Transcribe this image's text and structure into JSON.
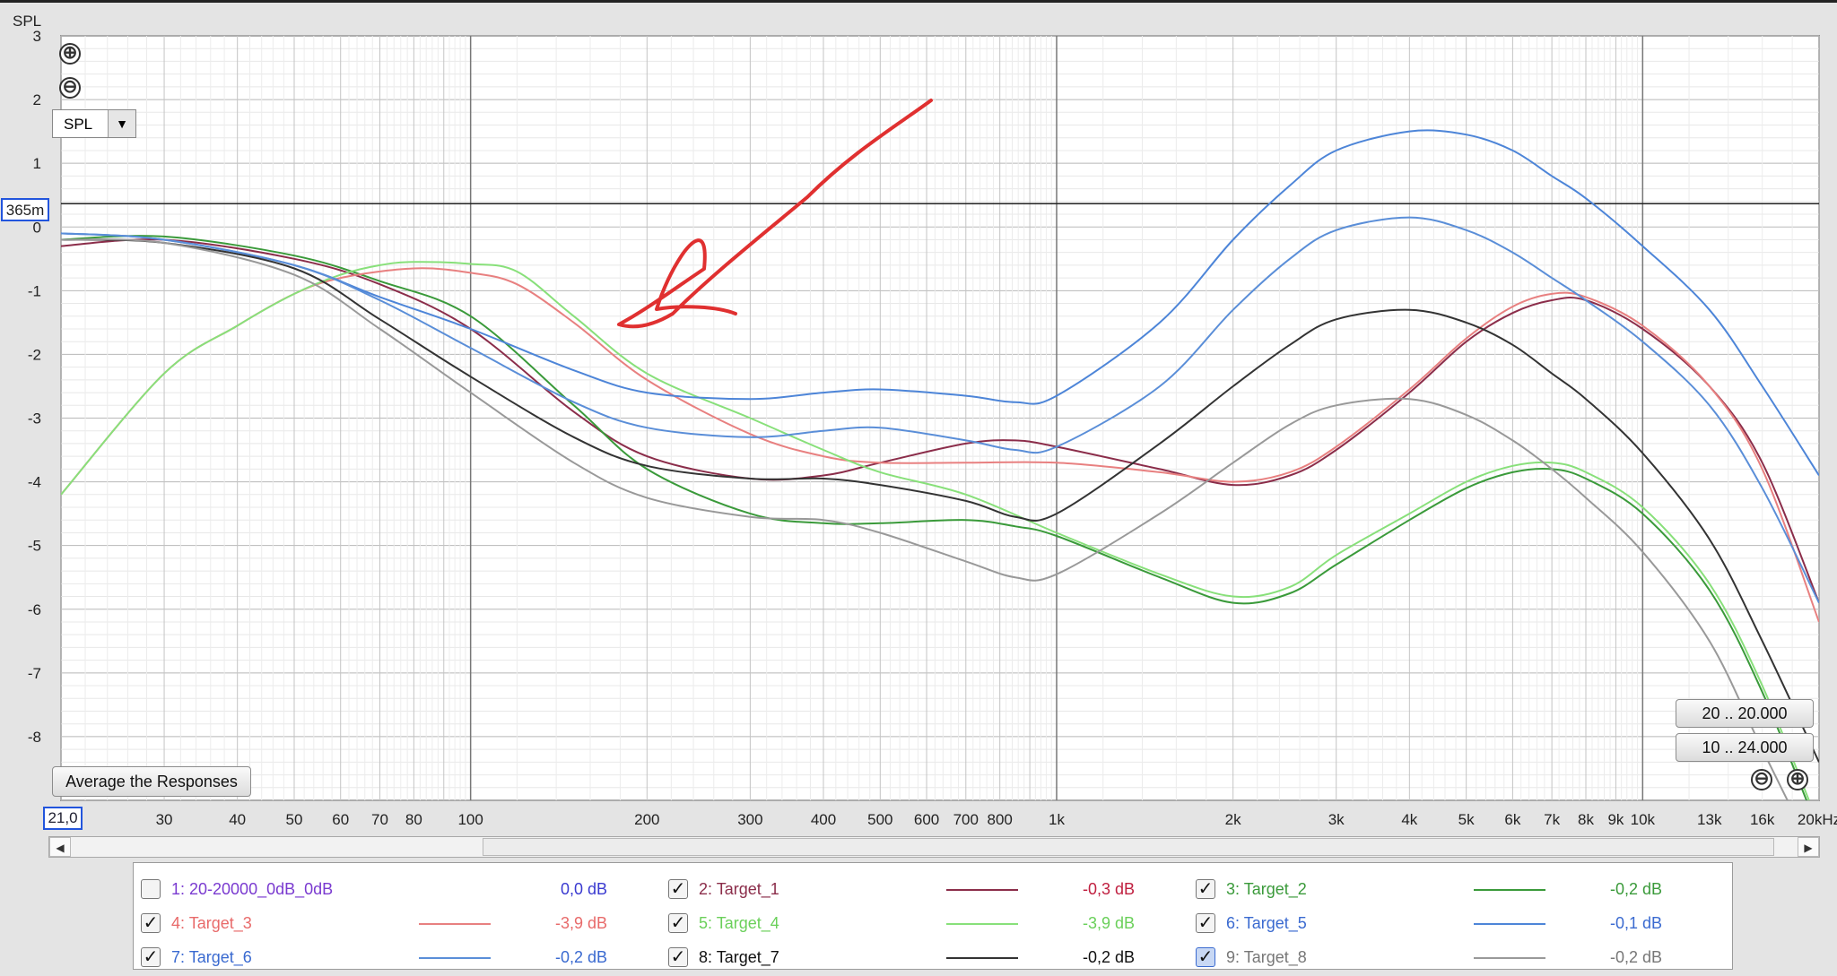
{
  "chart_data": {
    "type": "line",
    "title": "",
    "ylabel": "SPL",
    "xlabel": "",
    "x_scale": "log",
    "xlim": [
      20,
      20000
    ],
    "ylim": [
      -9,
      3
    ],
    "y_ticks": [
      "3",
      "2",
      "1",
      "0",
      "-1",
      "-2",
      "-3",
      "-4",
      "-5",
      "-6",
      "-7",
      "-8"
    ],
    "x_tick_labels": [
      {
        "f": 30,
        "t": "30"
      },
      {
        "f": 40,
        "t": "40"
      },
      {
        "f": 50,
        "t": "50"
      },
      {
        "f": 60,
        "t": "60"
      },
      {
        "f": 70,
        "t": "70"
      },
      {
        "f": 80,
        "t": "80"
      },
      {
        "f": 100,
        "t": "100"
      },
      {
        "f": 200,
        "t": "200"
      },
      {
        "f": 300,
        "t": "300"
      },
      {
        "f": 400,
        "t": "400"
      },
      {
        "f": 500,
        "t": "500"
      },
      {
        "f": 600,
        "t": "600"
      },
      {
        "f": 700,
        "t": "700"
      },
      {
        "f": 800,
        "t": "800"
      },
      {
        "f": 1000,
        "t": "1k"
      },
      {
        "f": 2000,
        "t": "2k"
      },
      {
        "f": 3000,
        "t": "3k"
      },
      {
        "f": 4000,
        "t": "4k"
      },
      {
        "f": 5000,
        "t": "5k"
      },
      {
        "f": 6000,
        "t": "6k"
      },
      {
        "f": 7000,
        "t": "7k"
      },
      {
        "f": 8000,
        "t": "8k"
      },
      {
        "f": 9000,
        "t": "9k"
      },
      {
        "f": 10000,
        "t": "10k"
      },
      {
        "f": 13000,
        "t": "13k"
      },
      {
        "f": 16000,
        "t": "16k"
      },
      {
        "f": 20000,
        "t": "20kHz"
      }
    ],
    "cursor_value": "365m",
    "cursor_y": 0.365,
    "start_freq_label": "21,0",
    "series": [
      {
        "name": "Target_1",
        "color": "#8b2d4a",
        "points": [
          [
            20,
            -0.3
          ],
          [
            30,
            -0.2
          ],
          [
            50,
            -0.5
          ],
          [
            70,
            -0.9
          ],
          [
            100,
            -1.6
          ],
          [
            150,
            -2.9
          ],
          [
            200,
            -3.6
          ],
          [
            300,
            -3.95
          ],
          [
            400,
            -3.9
          ],
          [
            500,
            -3.7
          ],
          [
            700,
            -3.4
          ],
          [
            850,
            -3.35
          ],
          [
            1000,
            -3.45
          ],
          [
            1500,
            -3.8
          ],
          [
            2000,
            -4.05
          ],
          [
            2500,
            -3.9
          ],
          [
            3000,
            -3.5
          ],
          [
            4000,
            -2.6
          ],
          [
            5000,
            -1.8
          ],
          [
            6000,
            -1.35
          ],
          [
            7000,
            -1.15
          ],
          [
            8000,
            -1.15
          ],
          [
            10000,
            -1.6
          ],
          [
            13000,
            -2.5
          ],
          [
            16000,
            -3.7
          ],
          [
            20000,
            -5.9
          ]
        ]
      },
      {
        "name": "Target_2",
        "color": "#3a9a3a",
        "points": [
          [
            20,
            -0.2
          ],
          [
            30,
            -0.15
          ],
          [
            50,
            -0.45
          ],
          [
            70,
            -0.85
          ],
          [
            100,
            -1.4
          ],
          [
            150,
            -2.8
          ],
          [
            200,
            -3.8
          ],
          [
            300,
            -4.5
          ],
          [
            400,
            -4.65
          ],
          [
            500,
            -4.65
          ],
          [
            700,
            -4.6
          ],
          [
            850,
            -4.7
          ],
          [
            1000,
            -4.85
          ],
          [
            1500,
            -5.5
          ],
          [
            2000,
            -5.9
          ],
          [
            2500,
            -5.75
          ],
          [
            3000,
            -5.3
          ],
          [
            4000,
            -4.6
          ],
          [
            5000,
            -4.1
          ],
          [
            6000,
            -3.85
          ],
          [
            7000,
            -3.8
          ],
          [
            8000,
            -3.95
          ],
          [
            10000,
            -4.5
          ],
          [
            13000,
            -5.7
          ],
          [
            16000,
            -7.3
          ],
          [
            20000,
            -9.5
          ]
        ]
      },
      {
        "name": "Target_3",
        "color": "#e88080",
        "points": [
          [
            20,
            -4.2
          ],
          [
            30,
            -2.3
          ],
          [
            40,
            -1.55
          ],
          [
            50,
            -1.05
          ],
          [
            60,
            -0.8
          ],
          [
            80,
            -0.65
          ],
          [
            100,
            -0.72
          ],
          [
            120,
            -0.9
          ],
          [
            150,
            -1.5
          ],
          [
            200,
            -2.4
          ],
          [
            300,
            -3.25
          ],
          [
            400,
            -3.6
          ],
          [
            500,
            -3.7
          ],
          [
            700,
            -3.7
          ],
          [
            1000,
            -3.7
          ],
          [
            1500,
            -3.85
          ],
          [
            2000,
            -4.0
          ],
          [
            2500,
            -3.85
          ],
          [
            3000,
            -3.45
          ],
          [
            4000,
            -2.55
          ],
          [
            5000,
            -1.75
          ],
          [
            6000,
            -1.25
          ],
          [
            7000,
            -1.05
          ],
          [
            8000,
            -1.1
          ],
          [
            10000,
            -1.55
          ],
          [
            13000,
            -2.5
          ],
          [
            16000,
            -3.8
          ],
          [
            20000,
            -6.2
          ]
        ]
      },
      {
        "name": "Target_4",
        "color": "#88e07a",
        "points": [
          [
            20,
            -4.2
          ],
          [
            30,
            -2.3
          ],
          [
            40,
            -1.55
          ],
          [
            50,
            -1.05
          ],
          [
            60,
            -0.75
          ],
          [
            70,
            -0.6
          ],
          [
            80,
            -0.55
          ],
          [
            100,
            -0.58
          ],
          [
            120,
            -0.7
          ],
          [
            150,
            -1.4
          ],
          [
            200,
            -2.3
          ],
          [
            300,
            -3.0
          ],
          [
            400,
            -3.5
          ],
          [
            500,
            -3.85
          ],
          [
            700,
            -4.2
          ],
          [
            1000,
            -4.8
          ],
          [
            1500,
            -5.45
          ],
          [
            2000,
            -5.8
          ],
          [
            2500,
            -5.65
          ],
          [
            3000,
            -5.15
          ],
          [
            4000,
            -4.5
          ],
          [
            5000,
            -4.0
          ],
          [
            6000,
            -3.75
          ],
          [
            7000,
            -3.7
          ],
          [
            8000,
            -3.85
          ],
          [
            10000,
            -4.4
          ],
          [
            13000,
            -5.6
          ],
          [
            16000,
            -7.2
          ],
          [
            20000,
            -9.4
          ]
        ]
      },
      {
        "name": "Target_5",
        "color": "#4d85d8",
        "points": [
          [
            20,
            -0.1
          ],
          [
            30,
            -0.2
          ],
          [
            50,
            -0.6
          ],
          [
            70,
            -1.1
          ],
          [
            100,
            -1.6
          ],
          [
            150,
            -2.25
          ],
          [
            200,
            -2.6
          ],
          [
            300,
            -2.7
          ],
          [
            400,
            -2.6
          ],
          [
            500,
            -2.55
          ],
          [
            700,
            -2.65
          ],
          [
            850,
            -2.75
          ],
          [
            1000,
            -2.65
          ],
          [
            1500,
            -1.5
          ],
          [
            2000,
            -0.2
          ],
          [
            2500,
            0.65
          ],
          [
            3000,
            1.2
          ],
          [
            4000,
            1.5
          ],
          [
            5000,
            1.45
          ],
          [
            6000,
            1.2
          ],
          [
            7000,
            0.8
          ],
          [
            8000,
            0.45
          ],
          [
            10000,
            -0.3
          ],
          [
            13000,
            -1.3
          ],
          [
            16000,
            -2.5
          ],
          [
            20000,
            -3.9
          ]
        ]
      },
      {
        "name": "Target_6",
        "color": "#5a8ed8",
        "points": [
          [
            20,
            -0.1
          ],
          [
            30,
            -0.2
          ],
          [
            50,
            -0.6
          ],
          [
            70,
            -1.15
          ],
          [
            100,
            -1.9
          ],
          [
            150,
            -2.75
          ],
          [
            200,
            -3.15
          ],
          [
            300,
            -3.3
          ],
          [
            400,
            -3.2
          ],
          [
            500,
            -3.15
          ],
          [
            700,
            -3.35
          ],
          [
            850,
            -3.5
          ],
          [
            1000,
            -3.45
          ],
          [
            1500,
            -2.5
          ],
          [
            2000,
            -1.3
          ],
          [
            2500,
            -0.5
          ],
          [
            3000,
            -0.05
          ],
          [
            4000,
            0.15
          ],
          [
            5000,
            -0.05
          ],
          [
            6000,
            -0.4
          ],
          [
            7000,
            -0.8
          ],
          [
            8000,
            -1.15
          ],
          [
            10000,
            -1.8
          ],
          [
            13000,
            -2.8
          ],
          [
            16000,
            -4.1
          ],
          [
            20000,
            -5.9
          ]
        ]
      },
      {
        "name": "Target_7",
        "color": "#333333",
        "points": [
          [
            20,
            -0.2
          ],
          [
            30,
            -0.25
          ],
          [
            50,
            -0.65
          ],
          [
            70,
            -1.45
          ],
          [
            100,
            -2.35
          ],
          [
            150,
            -3.3
          ],
          [
            200,
            -3.75
          ],
          [
            300,
            -3.95
          ],
          [
            400,
            -3.95
          ],
          [
            500,
            -4.05
          ],
          [
            700,
            -4.3
          ],
          [
            850,
            -4.55
          ],
          [
            1000,
            -4.5
          ],
          [
            1500,
            -3.4
          ],
          [
            2000,
            -2.5
          ],
          [
            2500,
            -1.85
          ],
          [
            3000,
            -1.45
          ],
          [
            4000,
            -1.3
          ],
          [
            5000,
            -1.5
          ],
          [
            6000,
            -1.85
          ],
          [
            7000,
            -2.3
          ],
          [
            8000,
            -2.7
          ],
          [
            10000,
            -3.55
          ],
          [
            13000,
            -4.9
          ],
          [
            16000,
            -6.5
          ],
          [
            20000,
            -8.4
          ]
        ]
      },
      {
        "name": "Target_8",
        "color": "#999999",
        "points": [
          [
            20,
            -0.2
          ],
          [
            30,
            -0.25
          ],
          [
            50,
            -0.75
          ],
          [
            70,
            -1.6
          ],
          [
            100,
            -2.6
          ],
          [
            150,
            -3.7
          ],
          [
            200,
            -4.25
          ],
          [
            300,
            -4.55
          ],
          [
            400,
            -4.6
          ],
          [
            500,
            -4.8
          ],
          [
            700,
            -5.25
          ],
          [
            850,
            -5.5
          ],
          [
            1000,
            -5.45
          ],
          [
            1500,
            -4.5
          ],
          [
            2000,
            -3.7
          ],
          [
            2500,
            -3.1
          ],
          [
            3000,
            -2.8
          ],
          [
            4000,
            -2.7
          ],
          [
            5000,
            -2.95
          ],
          [
            6000,
            -3.35
          ],
          [
            7000,
            -3.8
          ],
          [
            8000,
            -4.25
          ],
          [
            10000,
            -5.1
          ],
          [
            13000,
            -6.5
          ],
          [
            16000,
            -8.2
          ],
          [
            20000,
            -10.0
          ]
        ]
      }
    ]
  },
  "ui": {
    "spl_label": "SPL",
    "dropdown_value": "SPL",
    "dropdown_arrow": "▼",
    "zoom_in_icon": "⊕",
    "zoom_out_icon": "⊖",
    "avg_button": "Average the Responses",
    "range_btn_1": "20 .. 20.000",
    "range_btn_2": "10 .. 24.000",
    "scroll_left": "◀",
    "scroll_right": "▶",
    "annotation_color": "#e03030"
  },
  "legend": [
    {
      "label": "1: 20-20000_0dB_0dB",
      "value": "0,0 dB",
      "checked": false,
      "label_color": "#7a3ad0",
      "value_color": "#3a3ad0",
      "swatch": ""
    },
    {
      "label": "2: Target_1",
      "value": "-0,3 dB",
      "checked": true,
      "label_color": "#8b2d4a",
      "value_color": "#c02040",
      "swatch": "#8b2d4a"
    },
    {
      "label": "3: Target_2",
      "value": "-0,2 dB",
      "checked": true,
      "label_color": "#3a9a3a",
      "value_color": "#3a9a3a",
      "swatch": "#3a9a3a"
    },
    {
      "label": "4: Target_3",
      "value": "-3,9 dB",
      "checked": true,
      "label_color": "#e86a6a",
      "value_color": "#e86a6a",
      "swatch": "#e88080"
    },
    {
      "label": "5: Target_4",
      "value": "-3,9 dB",
      "checked": true,
      "label_color": "#6ad05a",
      "value_color": "#6ad05a",
      "swatch": "#88e07a"
    },
    {
      "label": "6: Target_5",
      "value": "-0,1 dB",
      "checked": true,
      "label_color": "#3a6ad0",
      "value_color": "#3a6ad0",
      "swatch": "#4d85d8"
    },
    {
      "label": "7: Target_6",
      "value": "-0,2 dB",
      "checked": true,
      "label_color": "#3a6ad0",
      "value_color": "#3a6ad0",
      "swatch": "#5a8ed8"
    },
    {
      "label": "8: Target_7",
      "value": "-0,2 dB",
      "checked": true,
      "label_color": "#111111",
      "value_color": "#111111",
      "swatch": "#333333"
    },
    {
      "label": "9: Target_8",
      "value": "-0,2 dB",
      "checked": true,
      "label_color": "#777777",
      "value_color": "#777777",
      "swatch": "#999999",
      "highlight": true
    }
  ]
}
